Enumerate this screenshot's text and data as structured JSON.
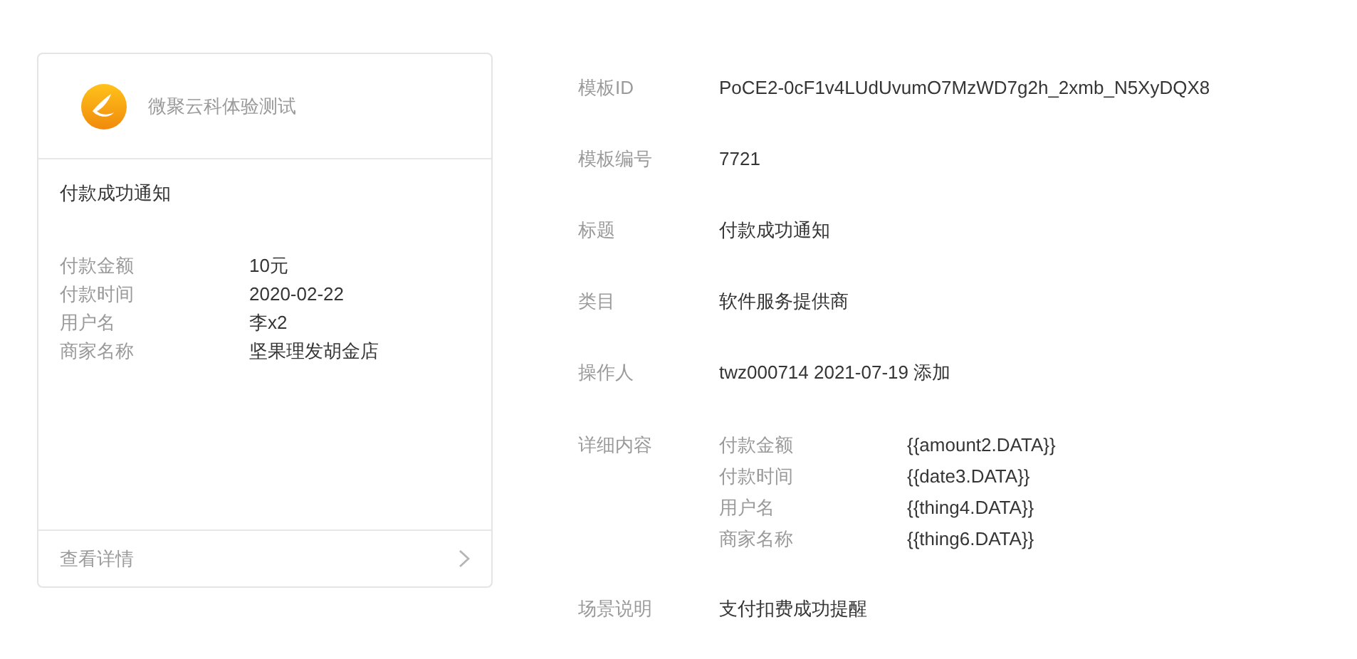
{
  "card": {
    "account_name": "微聚云科体验测试",
    "title": "付款成功通知",
    "fields": [
      {
        "label": "付款金额",
        "value": "10元"
      },
      {
        "label": "付款时间",
        "value": "2020-02-22"
      },
      {
        "label": "用户名",
        "value": "李x2"
      },
      {
        "label": "商家名称",
        "value": "坚果理发胡金店"
      }
    ],
    "footer_link": "查看详情"
  },
  "details": [
    {
      "label": "模板ID",
      "value": "PoCE2-0cF1v4LUdUvumO7MzWD7g2h_2xmb_N5XyDQX8"
    },
    {
      "label": "模板编号",
      "value": "7721"
    },
    {
      "label": "标题",
      "value": "付款成功通知"
    },
    {
      "label": "类目",
      "value": "软件服务提供商"
    },
    {
      "label": "操作人",
      "value": "twz000714 2021-07-19 添加"
    }
  ],
  "content": {
    "label": "详细内容",
    "fields": [
      {
        "label": "付款金额",
        "value": "{{amount2.DATA}}"
      },
      {
        "label": "付款时间",
        "value": "{{date3.DATA}}"
      },
      {
        "label": "用户名",
        "value": "{{thing4.DATA}}"
      },
      {
        "label": "商家名称",
        "value": "{{thing6.DATA}}"
      }
    ]
  },
  "scene": {
    "label": "场景说明",
    "value": "支付扣费成功提醒"
  }
}
